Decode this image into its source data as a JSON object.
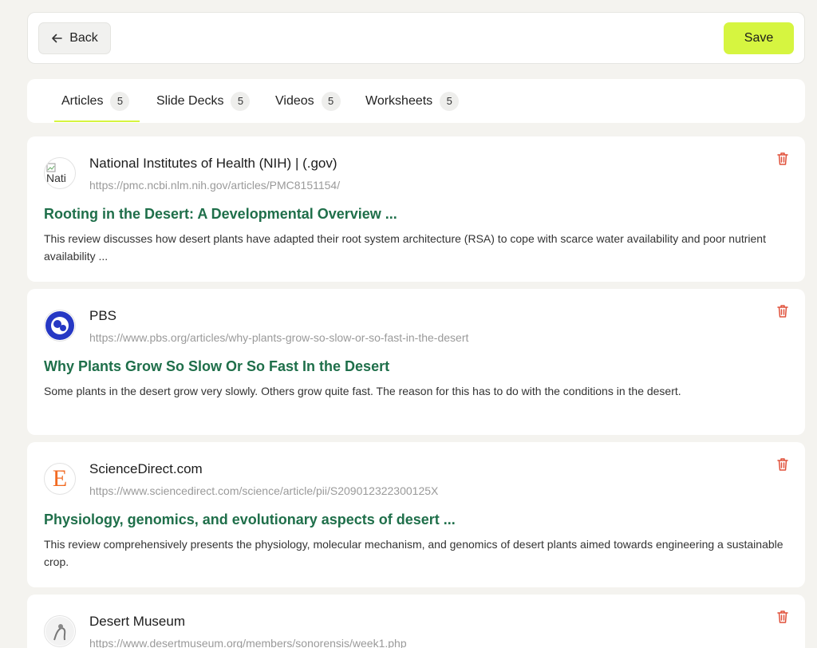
{
  "header": {
    "back_label": "Back",
    "save_label": "Save"
  },
  "tabs": [
    {
      "label": "Articles",
      "count": "5"
    },
    {
      "label": "Slide Decks",
      "count": "5"
    },
    {
      "label": "Videos",
      "count": "5"
    },
    {
      "label": "Worksheets",
      "count": "5"
    }
  ],
  "articles": [
    {
      "source": "National Institutes of Health (NIH) | (.gov)",
      "url": "https://pmc.ncbi.nlm.nih.gov/articles/PMC8151154/",
      "title": "Rooting in the Desert: A Developmental Overview ...",
      "description": "This review discusses how desert plants have adapted their root system architecture (RSA) to cope with scarce water availability and poor nutrient availability ...",
      "logo_alt": "Nati"
    },
    {
      "source": "PBS",
      "url": "https://www.pbs.org/articles/why-plants-grow-so-slow-or-so-fast-in-the-desert",
      "title": "Why Plants Grow So Slow Or So Fast In the Desert",
      "description": "Some plants in the desert grow very slowly. Others grow quite fast. The reason for this has to do with the conditions in the desert."
    },
    {
      "source": "ScienceDirect.com",
      "url": "https://www.sciencedirect.com/science/article/pii/S209012322300125X",
      "title": "Physiology, genomics, and evolutionary aspects of desert ...",
      "description": "This review comprehensively presents the physiology, molecular mechanism, and genomics of desert plants aimed towards engineering a sustainable crop.",
      "logo_letter": "E"
    },
    {
      "source": "Desert Museum",
      "url": "https://www.desertmuseum.org/members/sonorensis/week1.php"
    }
  ],
  "colors": {
    "accent": "#d6f540",
    "title": "#1f6f4a",
    "trash": "#e0503a",
    "pbs": "#2638c4",
    "elsevier": "#f26a21"
  }
}
